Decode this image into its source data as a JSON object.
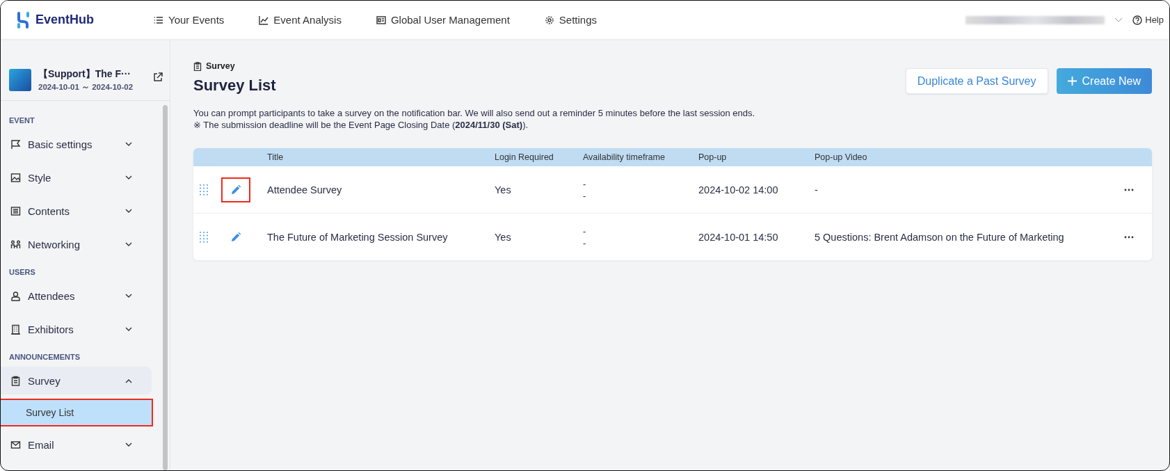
{
  "nav": {
    "logo": "EventHub",
    "items": [
      "Your Events",
      "Event Analysis",
      "Global User Management",
      "Settings"
    ],
    "help": "Help"
  },
  "event": {
    "title": "【Support】The F···",
    "dates": "2024-10-01 ～ 2024-10-02"
  },
  "sidebar": {
    "sections": [
      {
        "label": "EVENT",
        "items": [
          {
            "label": "Basic settings",
            "expanded": false
          },
          {
            "label": "Style",
            "expanded": false
          },
          {
            "label": "Contents",
            "expanded": false
          },
          {
            "label": "Networking",
            "expanded": false
          }
        ]
      },
      {
        "label": "USERS",
        "items": [
          {
            "label": "Attendees",
            "expanded": false
          },
          {
            "label": "Exhibitors",
            "expanded": false
          }
        ]
      },
      {
        "label": "ANNOUNCEMENTS",
        "items": [
          {
            "label": "Survey",
            "expanded": true,
            "children": [
              {
                "label": "Survey List",
                "selected": true,
                "highlighted": true
              }
            ]
          },
          {
            "label": "Email",
            "expanded": false
          }
        ]
      }
    ]
  },
  "page": {
    "breadcrumb": "Survey",
    "title": "Survey List",
    "buttons": {
      "duplicate": "Duplicate a Past Survey",
      "create": "Create New"
    },
    "notice": [
      "You can prompt participants to take a survey on the notification bar. We will also send out a reminder 5 minutes before the last session ends.",
      "※ The submission deadline will be the Event Page Closing Date (**2024/11/30 (Sat)**)."
    ]
  },
  "table": {
    "columns": [
      "Title",
      "Login Required",
      "Availability timeframe",
      "Pop-up",
      "Pop-up Video"
    ],
    "rows": [
      {
        "title": "Attendee Survey",
        "login_required": "Yes",
        "availability": [
          "-",
          "-"
        ],
        "popup": "2024-10-02 14:00",
        "popup_video": "-",
        "highlighted": true
      },
      {
        "title": "The Future of Marketing Session Survey",
        "login_required": "Yes",
        "availability": [
          "-",
          "-"
        ],
        "popup": "2024-10-01 14:50",
        "popup_video": "5 Questions: Brent Adamson on the Future of Marketing",
        "highlighted": false
      }
    ]
  }
}
